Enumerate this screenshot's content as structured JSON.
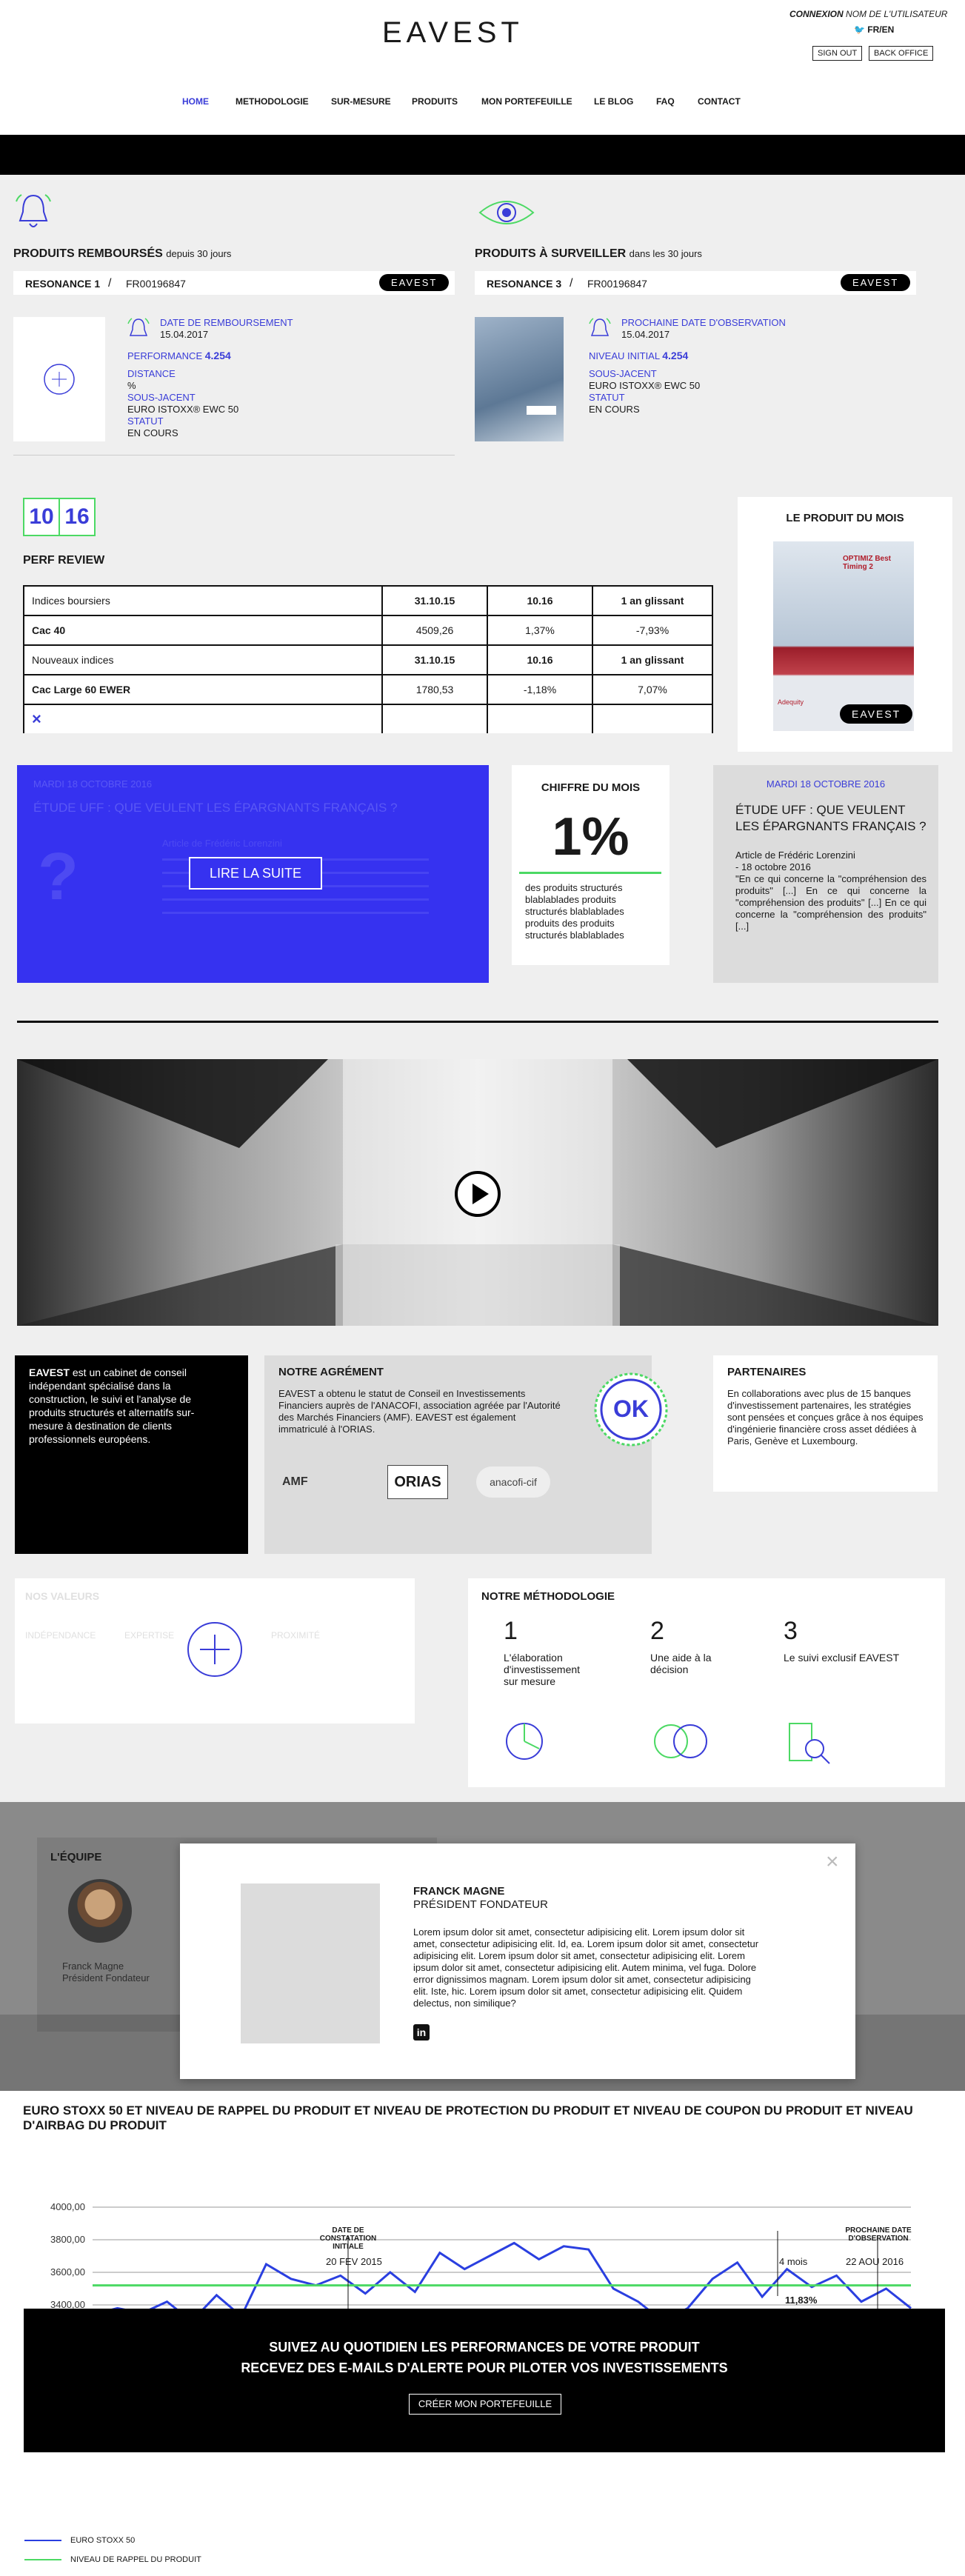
{
  "header": {
    "logo": "EAVEST",
    "connexion_label": "CONNEXION",
    "user_name": "NOM DE L'UTILISATEUR",
    "lang": "FR/EN",
    "sign_out": "SIGN OUT",
    "back_office": "BACK OFFICE",
    "nav": [
      "HOME",
      "METHODOLOGIE",
      "SUR-MESURE",
      "PRODUITS",
      "MON PORTEFEUILLE",
      "LE BLOG",
      "FAQ",
      "CONTACT"
    ]
  },
  "rembourses": {
    "title": "PRODUITS REMBOURSÉS",
    "subtitle": "depuis 30 jours",
    "product": "RESONANCE 1",
    "isin": "FR00196847",
    "brand": "EAVEST",
    "date_label": "DATE DE REMBOURSEMENT",
    "date_value": "15.04.2017",
    "perf_label": "PERFORMANCE",
    "perf_value": "4.254",
    "distance_label": "DISTANCE",
    "distance_value": "%",
    "sous_jacent_label": "SOUS-JACENT",
    "sous_jacent_value": "EURO ISTOXX® EWC 50",
    "statut_label": "STATUT",
    "statut_value": "EN COURS"
  },
  "surveiller": {
    "title": "PRODUITS À SURVEILLER",
    "subtitle": "dans les 30 jours",
    "product": "RESONANCE 3",
    "isin": "FR00196847",
    "brand": "EAVEST",
    "date_label": "PROCHAINE DATE D'OBSERVATION",
    "date_value": "15.04.2017",
    "niveau_label": "NIVEAU INITIAL",
    "niveau_value": "4.254",
    "sous_jacent_label": "SOUS-JACENT",
    "sous_jacent_value": "EURO ISTOXX® EWC 50",
    "statut_label": "STATUT",
    "statut_value": "EN COURS"
  },
  "perf": {
    "digits": [
      "10",
      "16"
    ],
    "title": "PERF REVIEW",
    "rows": [
      {
        "name": "Indices boursiers",
        "a": "31.10.15",
        "b": "10.16",
        "c": "1 an glissant",
        "header": true
      },
      {
        "name": "Cac 40",
        "a": "4509,26",
        "b": "1,37%",
        "c": "-7,93%",
        "header": false
      },
      {
        "name": "Nouveaux indices",
        "a": "31.10.15",
        "b": "10.16",
        "c": "1 an glissant",
        "header": true
      },
      {
        "name": "Cac Large 60 EWER",
        "a": "1780,53",
        "b": "-1,18%",
        "c": "7,07%",
        "header": false
      }
    ],
    "close": "×"
  },
  "produit_mois": {
    "title": "LE PRODUIT DU MOIS",
    "cover_title": "OPTIMIZ Best Timing 2",
    "cover_sub": "Adequity",
    "brand": "EAVEST"
  },
  "blog_blue": {
    "date": "MARDI 18 OCTOBRE 2016",
    "title": "ÉTUDE UFF : QUE VEULENT LES ÉPARGNANTS FRANÇAIS ?",
    "byline": "Article de Frédéric Lorenzini",
    "cta": "LIRE LA SUITE"
  },
  "chiffre": {
    "title": "CHIFFRE DU MOIS",
    "value": "1%",
    "text": "des produits structurés blablablades produits structurés blablablades produits des produits structurés blablablades"
  },
  "blog_grey": {
    "date": "MARDI 18 OCTOBRE 2016",
    "title": "ÉTUDE UFF : QUE VEULENT LES ÉPARGNANTS FRANÇAIS ?",
    "byline": "Article de Frédéric Lorenzini",
    "date2": "- 18 octobre 2016",
    "text": "\"En ce qui concerne la \"compréhension des produits\" [...] En ce qui concerne la \"compréhension des produits\" [...] En ce qui concerne la \"compréhension des produits\" [...]"
  },
  "about": {
    "brand": "EAVEST",
    "text": " est un cabinet de conseil indépendant spécialisé dans la construction, le suivi et l'analyse de produits structurés et alternatifs sur-mesure à destination de clients professionnels européens."
  },
  "agrement": {
    "title": "NOTRE AGRÉMENT",
    "text": "EAVEST a obtenu le statut de Conseil en Investissements Financiers auprès de l'ANACOFI, association agréée par l'Autorité des Marchés Financiers (AMF). EAVEST est également immatriculé à l'ORIAS.",
    "badge": "OK",
    "logos": [
      "AMF",
      "ORIAS",
      "anacofi-cif"
    ]
  },
  "partenaires": {
    "title": "PARTENAIRES",
    "text": "En collaborations avec plus de 15 banques d'investissement partenaires, les stratégies sont pensées et conçues grâce à nos équipes d'ingénierie financière cross asset dédiées à Paris, Genève et Luxembourg."
  },
  "valeurs": {
    "title": "NOS VALEURS",
    "items": [
      "INDÉPENDANCE",
      "EXPERTISE",
      "",
      "PROXIMITÉ"
    ]
  },
  "methodo": {
    "title": "NOTRE MÉTHODOLOGIE",
    "steps": [
      {
        "num": "1",
        "label": "L'élaboration d'investissement sur mesure"
      },
      {
        "num": "2",
        "label": "Une aide à la décision"
      },
      {
        "num": "3",
        "label": "Le suivi exclusif EAVEST"
      }
    ]
  },
  "equipe": {
    "title": "L'ÉQUIPE",
    "member_name": "Franck Magne",
    "member_role": "Président Fondateur"
  },
  "modal": {
    "close": "×",
    "name": "FRANCK MAGNE",
    "role": "PRÉSIDENT FONDATEUR",
    "bio": "Lorem ipsum dolor sit amet, consectetur adipisicing elit. Lorem ipsum dolor sit amet, consectetur adipisicing elit. Id, ea. Lorem ipsum dolor sit amet, consectetur adipisicing elit. Lorem ipsum dolor sit amet, consectetur adipisicing elit. Lorem ipsum dolor sit amet, consectetur adipisicing elit. Autem minima, vel fuga. Dolore error dignissimos magnam. Lorem ipsum dolor sit amet, consectetur adipisicing elit. Iste, hic. Lorem ipsum dolor sit amet, consectetur adipisicing elit. Quidem delectus, non similique?",
    "social": "in"
  },
  "graph": {
    "title": "EURO STOXX 50 ET NIVEAU DE RAPPEL DU PRODUIT ET NIVEAU DE PROTECTION DU PRODUIT ET NIVEAU DE COUPON DU PRODUIT ET NIVEAU D'AIRBAG DU PRODUIT",
    "annot_left_title": "DATE DE CONSTATATION INITIALE",
    "annot_left_date": "20 FEV 2015",
    "annot_right_title": "PROCHAINE DATE D'OBSERVATION",
    "annot_right_date": "22 AOU 2016",
    "annot_months": "4 mois",
    "annot_pct": "11,83%",
    "legend": [
      "EURO STOXX 50",
      "NIVEAU DE RAPPEL DU PRODUIT"
    ],
    "colors": {
      "index": "#2a3fe0",
      "rappel": "#4cd964"
    }
  },
  "chart_data": {
    "type": "line",
    "title": "EURO STOXX 50 ET NIVEAU DE RAPPEL DU PRODUIT ET NIVEAU DE PROTECTION DU PRODUIT ET NIVEAU DE COUPON DU PRODUIT ET NIVEAU D'AIRBAG DU PRODUIT",
    "yticks": [
      "4000,00",
      "3800,00",
      "3600,00",
      "3400,00"
    ],
    "ylim": [
      3300,
      4000
    ],
    "series": [
      {
        "name": "EURO STOXX 50",
        "values": [
          3340,
          3380,
          3350,
          3420,
          3300,
          3460,
          3330,
          3650,
          3560,
          3520,
          3580,
          3470,
          3600,
          3480,
          3720,
          3620,
          3700,
          3780,
          3680,
          3760,
          3740,
          3500,
          3420,
          3300,
          3380,
          3560,
          3660,
          3450,
          3620,
          3510,
          3580,
          3420,
          3500,
          3380
        ]
      },
      {
        "name": "NIVEAU DE RAPPEL DU PRODUIT",
        "values": [
          3520,
          3520,
          3520,
          3520,
          3520,
          3520,
          3520,
          3520,
          3520,
          3520,
          3520,
          3520,
          3520,
          3520,
          3520,
          3520,
          3520,
          3520,
          3520,
          3520,
          3520,
          3520,
          3520,
          3520,
          3520,
          3520,
          3520,
          3520,
          3520,
          3520,
          3520,
          3520,
          3520,
          3520
        ]
      }
    ],
    "grid": true
  },
  "cta": {
    "line1": "SUIVEZ AU QUOTIDIEN LES PERFORMANCES DE VOTRE PRODUIT",
    "line2": "RECEVEZ DES E-MAILS D'ALERTE POUR PILOTER VOS INVESTISSEMENTS",
    "button": "CRÉER MON PORTEFEUILLE"
  }
}
